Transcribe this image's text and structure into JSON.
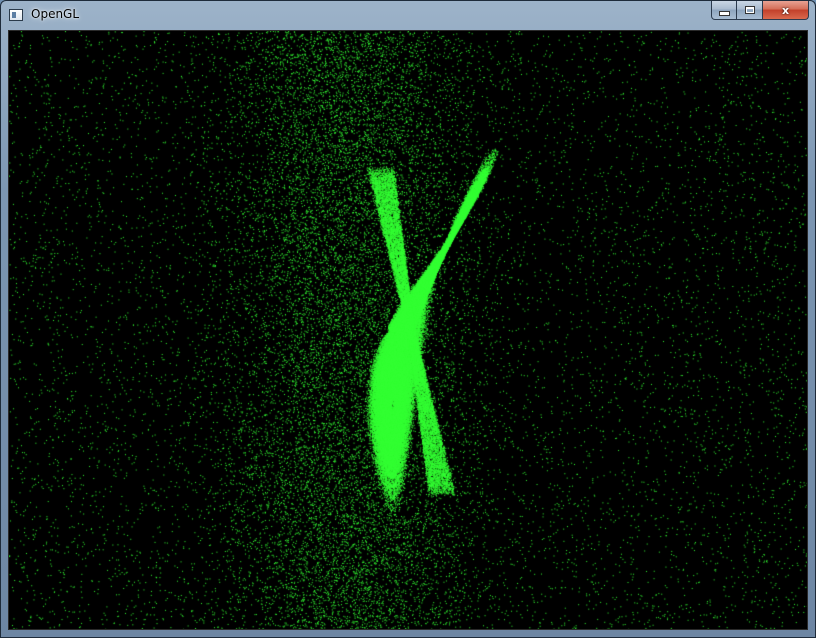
{
  "window": {
    "title": "OpenGL",
    "icon": "app-window-icon",
    "controls": {
      "minimize_icon": "minimize-icon",
      "maximize_icon": "maximize-icon",
      "close_label": "x"
    }
  },
  "viewport": {
    "background_color": "#000000",
    "point_color": "#33ff33",
    "content": "lorenz-attractor-point-cloud"
  }
}
